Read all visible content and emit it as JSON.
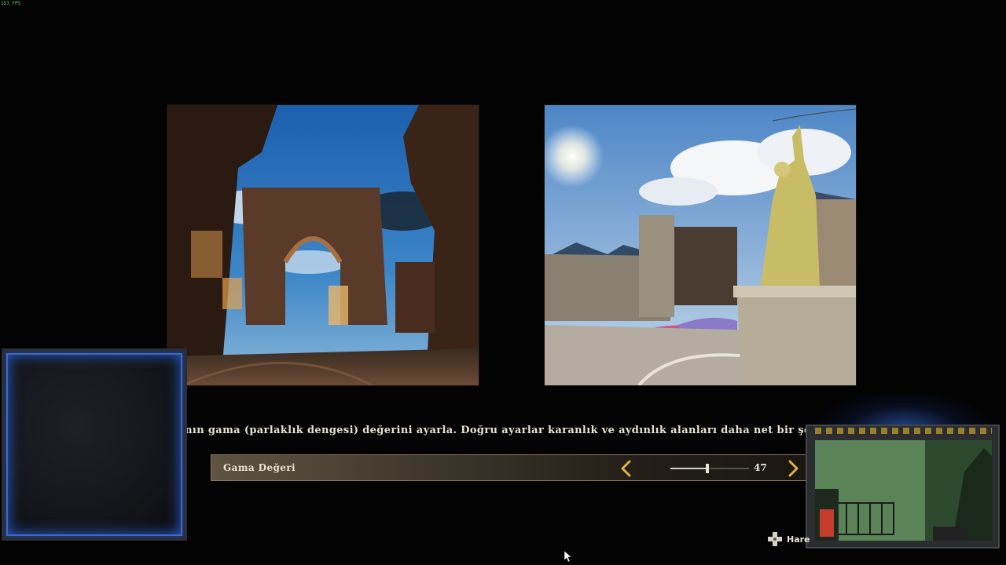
{
  "hud": {
    "fps_text": "153 FPS"
  },
  "description": "Oyun ekranının gama (parlaklık dengesi) değerini ayarla. Doğru ayarlar karanlık ve aydınlık alanları daha net bir şekilde ayır",
  "gamma": {
    "label": "Gama Değeri",
    "value": "47",
    "level_percent": 47
  },
  "hint": {
    "icon": "dpad-icon",
    "label": "Hare"
  },
  "colors": {
    "accent_arrow": "#e0b14a",
    "panel_glow": "#3c6ad0"
  }
}
